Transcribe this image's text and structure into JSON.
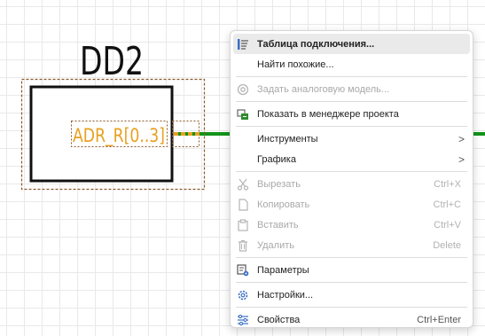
{
  "schematic": {
    "ref": "DD2",
    "pin_label": "ADR_R[0..3]"
  },
  "menu": {
    "items": [
      {
        "label": "Таблица подключения...",
        "icon": "connection-table-icon"
      },
      {
        "label": "Найти похожие..."
      },
      {
        "label": "Задать аналоговую модель...",
        "icon": "analog-model-icon"
      },
      {
        "label": "Показать в менеджере проекта",
        "icon": "project-manager-icon"
      },
      {
        "label": "Инструменты",
        "arrow": ">"
      },
      {
        "label": "Графика",
        "arrow": ">"
      },
      {
        "label": "Вырезать",
        "shortcut": "Ctrl+X",
        "icon": "cut-icon"
      },
      {
        "label": "Копировать",
        "shortcut": "Ctrl+C",
        "icon": "copy-icon"
      },
      {
        "label": "Вставить",
        "shortcut": "Ctrl+V",
        "icon": "paste-icon"
      },
      {
        "label": "Удалить",
        "shortcut": "Delete",
        "icon": "delete-icon"
      },
      {
        "label": "Параметры",
        "icon": "parameters-icon"
      },
      {
        "label": "Настройки...",
        "icon": "settings-icon"
      },
      {
        "label": "Свойства",
        "shortcut": "Ctrl+Enter",
        "icon": "properties-icon"
      }
    ]
  },
  "colors": {
    "wire_green": "#12941a",
    "pin_orange": "#e8a020",
    "selection_brown": "#8a5a2b"
  }
}
